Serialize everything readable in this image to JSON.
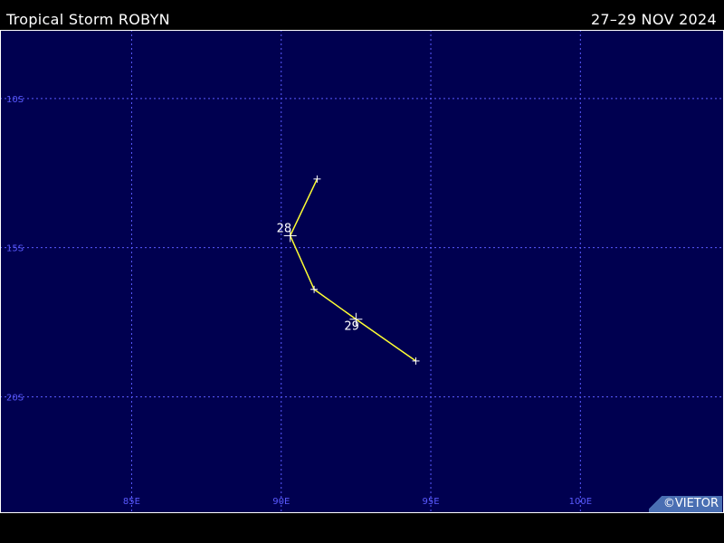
{
  "header": {
    "title": "Tropical Storm ROBYN",
    "date_range": "27–29 NOV 2024"
  },
  "map": {
    "lon_range": [
      80.6,
      104.8
    ],
    "lat_range": [
      7.7,
      23.9
    ],
    "lon_ticks": [
      {
        "value": 85,
        "label": "85E"
      },
      {
        "value": 90,
        "label": "90E"
      },
      {
        "value": 95,
        "label": "95E"
      },
      {
        "value": 100,
        "label": "100E"
      }
    ],
    "lat_ticks": [
      {
        "value": 10,
        "label": "10S"
      },
      {
        "value": 15,
        "label": "15S"
      },
      {
        "value": 20,
        "label": "20S"
      }
    ],
    "track": [
      {
        "lon": 91.2,
        "lat": 12.7
      },
      {
        "lon": 90.3,
        "lat": 14.6,
        "day": "28",
        "major": true
      },
      {
        "lon": 91.1,
        "lat": 16.4
      },
      {
        "lon": 92.5,
        "lat": 17.4,
        "day": "29",
        "major": true
      },
      {
        "lon": 94.5,
        "lat": 18.8
      }
    ]
  },
  "credit": "©VIETOR",
  "colors": {
    "ocean": "#000050",
    "grid": "#5a5aff",
    "track": "#ffff33",
    "marker": "#ffffff",
    "text": "#ffffff"
  }
}
